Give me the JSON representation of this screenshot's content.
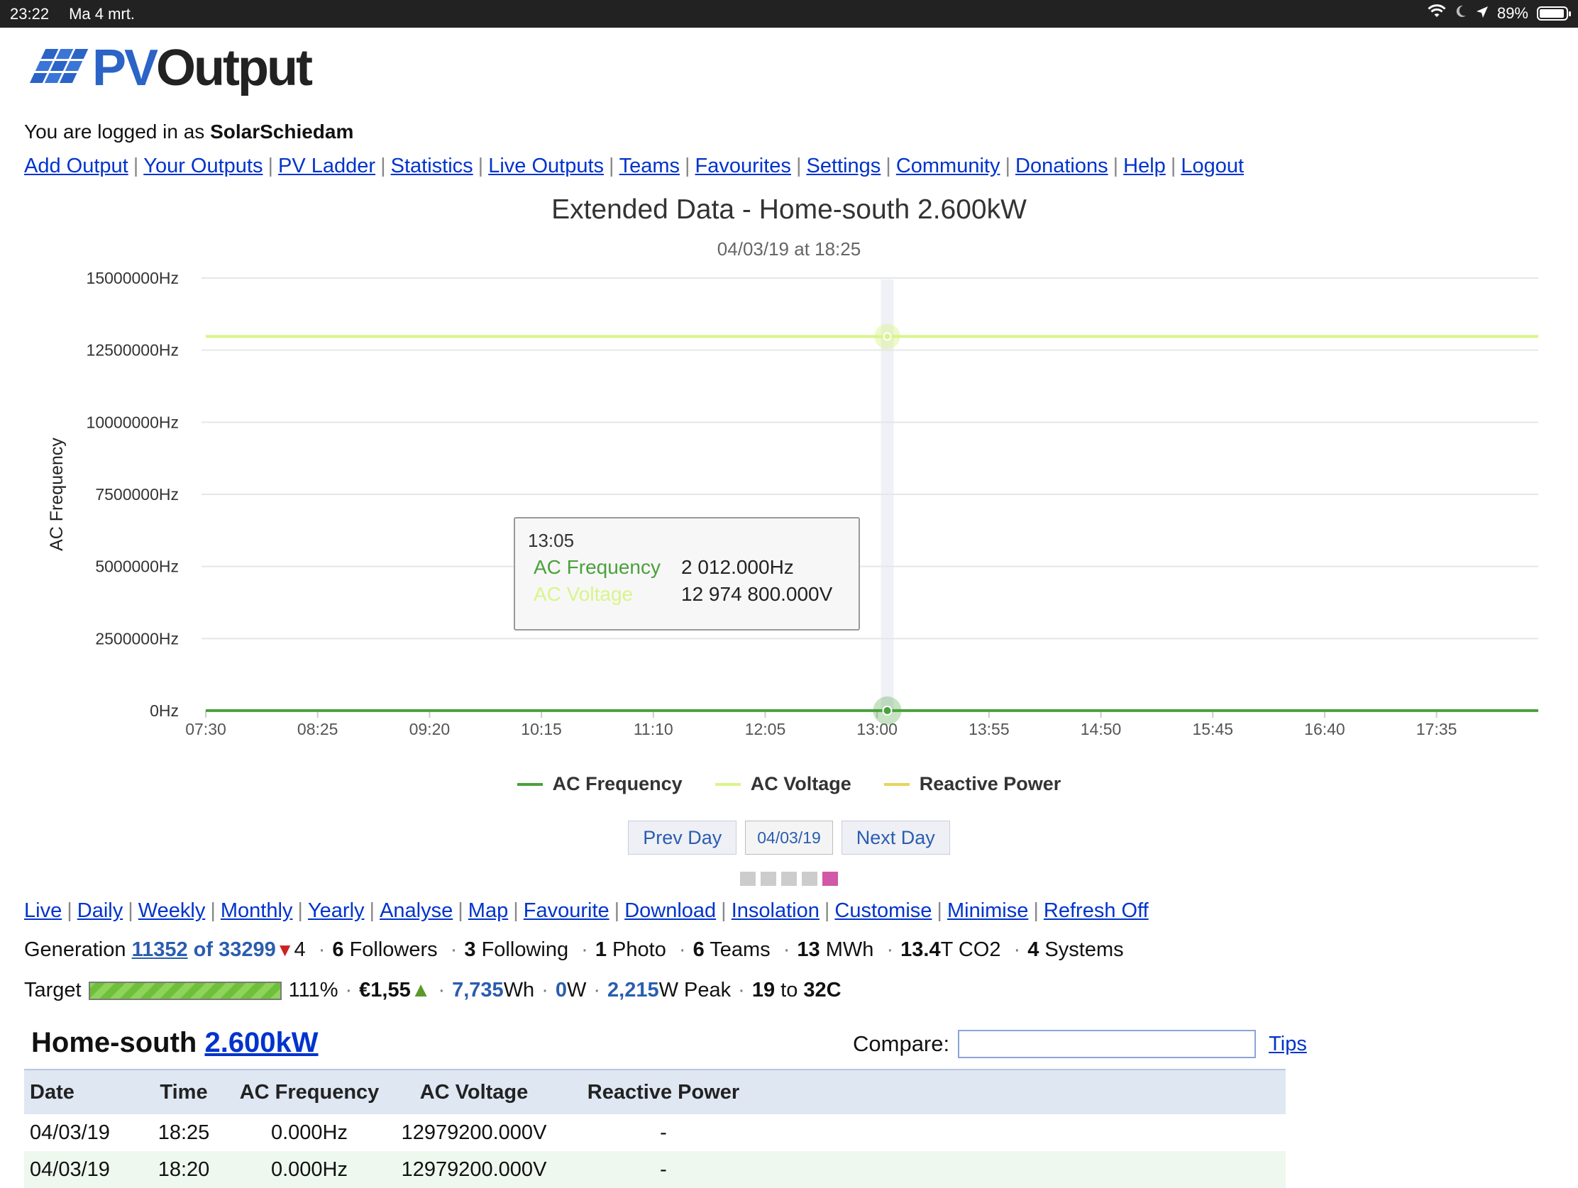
{
  "statusbar": {
    "time": "23:22",
    "date": "Ma 4 mrt.",
    "battery": "89%"
  },
  "logo": {
    "part1": "PV",
    "part2": "Output"
  },
  "login": {
    "prefix": "You are logged in as",
    "username": "SolarSchiedam"
  },
  "main_nav": [
    "Add Output",
    "Your Outputs",
    "PV Ladder",
    "Statistics",
    "Live Outputs",
    "Teams",
    "Favourites",
    "Settings",
    "Community",
    "Donations",
    "Help",
    "Logout"
  ],
  "chart": {
    "title": "Extended Data - Home-south 2.600kW",
    "subtitle": "04/03/19 at 18:25",
    "ylabel": "AC Frequency"
  },
  "chart_data": {
    "type": "line",
    "title": "Extended Data - Home-south 2.600kW",
    "subtitle": "04/03/19 at 18:25",
    "xlabel": "",
    "ylabel": "AC Frequency",
    "y_unit": "Hz",
    "y_ticks": [
      0,
      2500000,
      5000000,
      7500000,
      10000000,
      12500000,
      15000000
    ],
    "y_tick_labels": [
      "0Hz",
      "2500000Hz",
      "5000000Hz",
      "7500000Hz",
      "10000000Hz",
      "12500000Hz",
      "15000000Hz"
    ],
    "ylim": [
      0,
      15000000
    ],
    "x_tick_labels": [
      "07:30",
      "08:25",
      "09:20",
      "10:15",
      "11:10",
      "12:05",
      "13:00",
      "13:55",
      "14:50",
      "15:45",
      "16:40",
      "17:35"
    ],
    "x_range": [
      "07:30",
      "18:25"
    ],
    "grid": true,
    "legend_placement": "bottom",
    "series": [
      {
        "name": "AC Frequency",
        "color": "#4aa13c",
        "x": [
          "07:30",
          "13:05",
          "18:25"
        ],
        "values": [
          2012,
          2012,
          2012
        ]
      },
      {
        "name": "AC Voltage",
        "color": "#d8f58a",
        "x": [
          "07:30",
          "13:05",
          "18:25"
        ],
        "values": [
          12974800,
          12974800,
          12974800
        ]
      },
      {
        "name": "Reactive Power",
        "color": "#e8d45a",
        "x": [],
        "values": []
      }
    ],
    "crosshair_x": "13:05"
  },
  "tooltip": {
    "time": "13:05",
    "rows": [
      {
        "name": "AC Frequency",
        "value": "2 012.000Hz",
        "color": "#4aa13c"
      },
      {
        "name": "AC Voltage",
        "value": "12 974 800.000V",
        "color": "#d8f58a"
      }
    ]
  },
  "legend": [
    {
      "name": "AC Frequency",
      "color": "#4aa13c"
    },
    {
      "name": "AC Voltage",
      "color": "#d8f58a"
    },
    {
      "name": "Reactive Power",
      "color": "#e8d45a"
    }
  ],
  "daynav": {
    "prev": "Prev Day",
    "date": "04/03/19",
    "next": "Next Day"
  },
  "sub_nav": [
    "Live",
    "Daily",
    "Weekly",
    "Monthly",
    "Yearly",
    "Analyse",
    "Map",
    "Favourite",
    "Download",
    "Insolation",
    "Customise",
    "Minimise",
    "Refresh Off"
  ],
  "generation": {
    "label": "Generation",
    "rank": "11352",
    "of": "of 33299",
    "change": "4",
    "followers_count": "6",
    "followers_label": "Followers",
    "following_count": "3",
    "following_label": "Following",
    "photo_count": "1",
    "photo_label": "Photo",
    "teams_count": "6",
    "teams_label": "Teams",
    "mwh_count": "13",
    "mwh_label": "MWh",
    "co2_count": "13.4",
    "co2_label": "T CO2",
    "systems_count": "4",
    "systems_label": "Systems"
  },
  "target": {
    "label": "Target",
    "progress": 1.0,
    "percent": "111%",
    "money": "€1,55",
    "energy_value": "7,735",
    "energy_unit": "Wh",
    "power_value": "0",
    "power_unit": "W",
    "peak_value": "2,215",
    "peak_unit": "W Peak",
    "temp_low": "19",
    "temp_to": "to",
    "temp_high": "32C"
  },
  "system": {
    "name": "Home-south",
    "size": "2.600kW"
  },
  "compare": {
    "label": "Compare:",
    "value": "",
    "tips": "Tips"
  },
  "table": {
    "headers": [
      "Date",
      "Time",
      "AC Frequency",
      "AC Voltage",
      "Reactive Power"
    ],
    "rows": [
      [
        "04/03/19",
        "18:25",
        "0.000Hz",
        "12979200.000V",
        "-"
      ],
      [
        "04/03/19",
        "18:20",
        "0.000Hz",
        "12979200.000V",
        "-"
      ]
    ]
  }
}
